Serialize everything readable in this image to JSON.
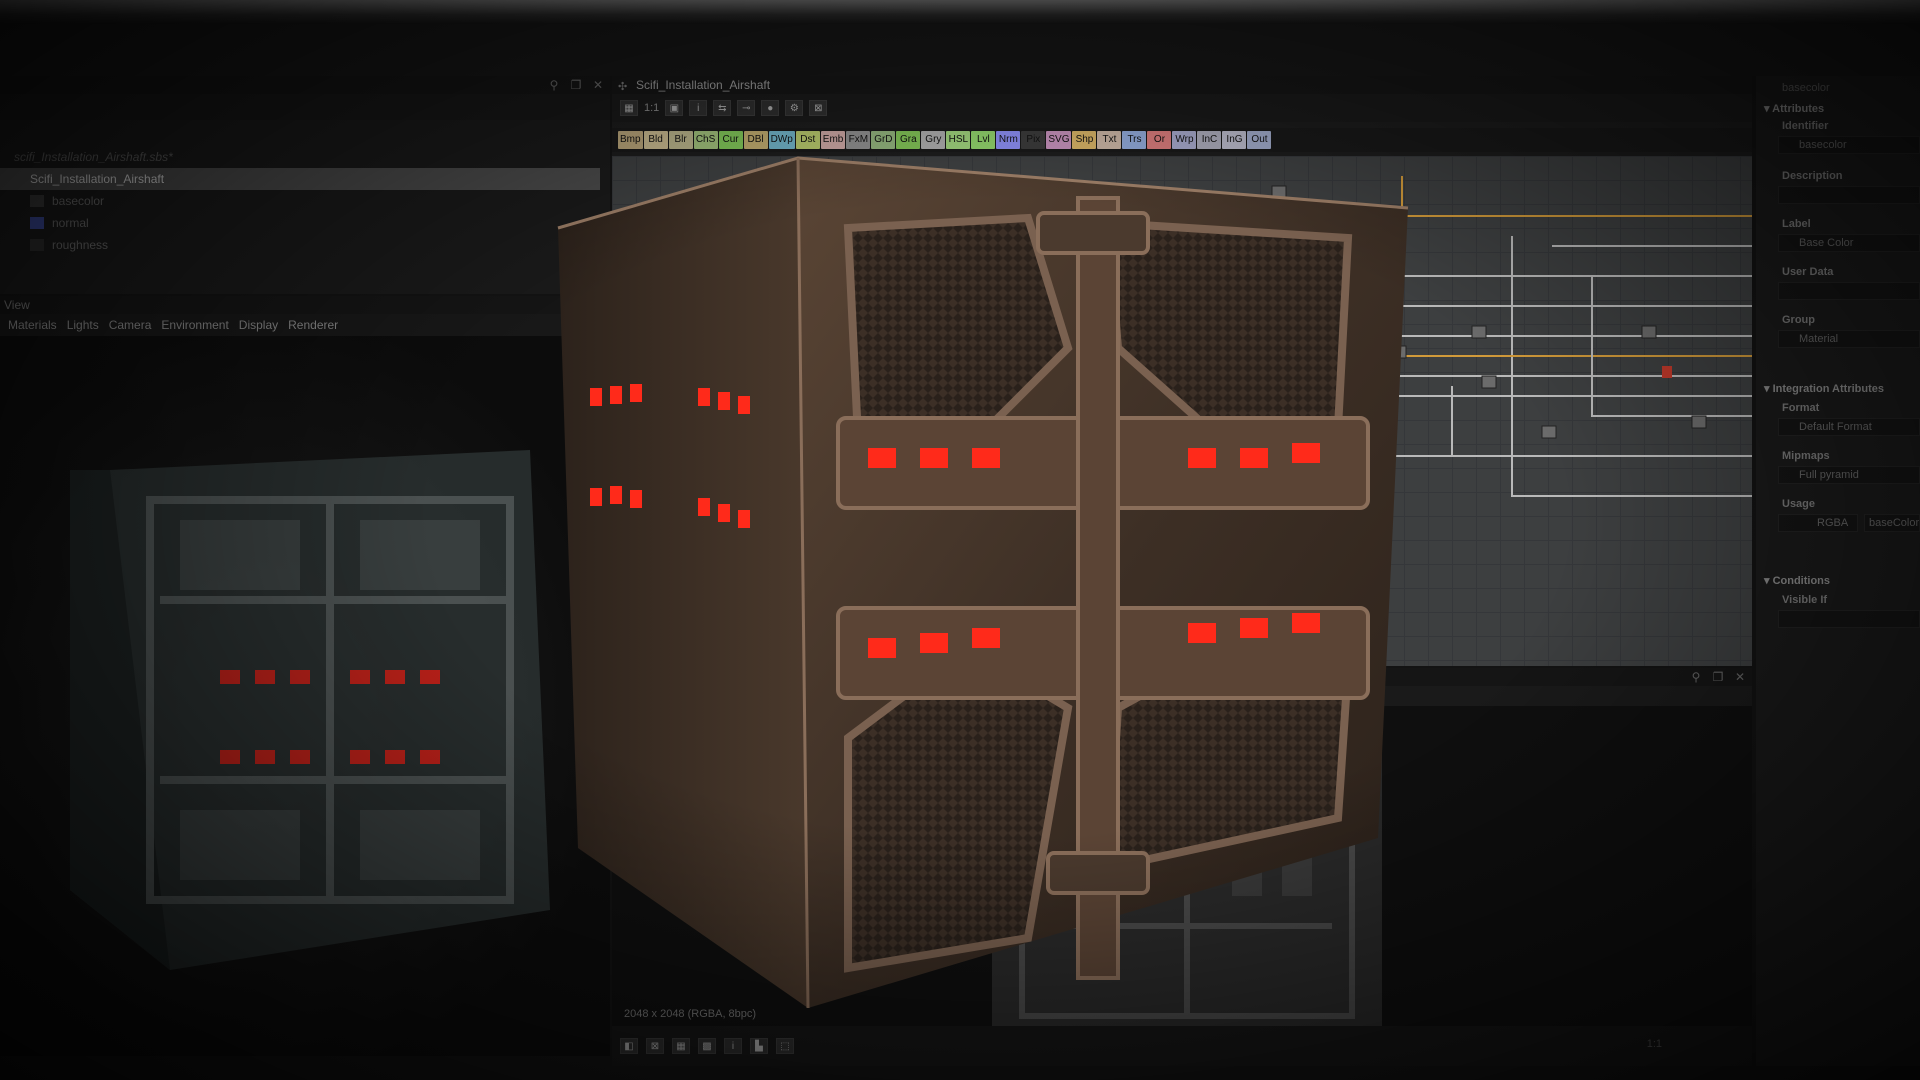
{
  "explorer": {
    "package": "scifi_Installation_Airshaft.sbs*",
    "graph": "Scifi_Installation_Airshaft",
    "outputs": [
      {
        "label": "basecolor",
        "color": "#3a3a3a"
      },
      {
        "label": "normal",
        "color": "#3b4a9a"
      },
      {
        "label": "roughness",
        "color": "#2e2e2e"
      }
    ]
  },
  "view3d": {
    "title": "View",
    "menu": [
      "Materials",
      "Lights",
      "Camera",
      "Environment",
      "Display",
      "Renderer"
    ]
  },
  "graph": {
    "title": "Scifi_Installation_Airshaft",
    "zoom_label": "1:1",
    "node_buttons": [
      {
        "label": "Bmp",
        "color": "#b9a57a"
      },
      {
        "label": "Bld",
        "color": "#c8b98f"
      },
      {
        "label": "Blr",
        "color": "#b8b38a"
      },
      {
        "label": "ChS",
        "color": "#9fbf7a"
      },
      {
        "label": "Cur",
        "color": "#7fc458"
      },
      {
        "label": "DBl",
        "color": "#bda96d"
      },
      {
        "label": "DWp",
        "color": "#6fb0c4"
      },
      {
        "label": "Dst",
        "color": "#b3c46a"
      },
      {
        "label": "Emb",
        "color": "#c7a3a0"
      },
      {
        "label": "FxM",
        "color": "#8c8c8c"
      },
      {
        "label": "GrD",
        "color": "#8fb07a"
      },
      {
        "label": "Gra",
        "color": "#7fbf55"
      },
      {
        "label": "Gry",
        "color": "#a9a9a9"
      },
      {
        "label": "HSL",
        "color": "#9ccf7a"
      },
      {
        "label": "Lvl",
        "color": "#8fd06a"
      },
      {
        "label": "Nrm",
        "color": "#8a8cf0"
      },
      {
        "label": "Pix",
        "color": "#3a3a3a"
      },
      {
        "label": "SVG",
        "color": "#c28fb8"
      },
      {
        "label": "Shp",
        "color": "#d4b065"
      },
      {
        "label": "Txt",
        "color": "#c7b2a2"
      },
      {
        "label": "Trs",
        "color": "#8fa7d6"
      },
      {
        "label": "Or",
        "color": "#d67a7a"
      },
      {
        "label": "Wrp",
        "color": "#a4a6c8"
      },
      {
        "label": "InC",
        "color": "#a9a9b8"
      },
      {
        "label": "InG",
        "color": "#b8b8c8"
      },
      {
        "label": "Out",
        "color": "#9fa9c8"
      }
    ]
  },
  "view2d": {
    "image_info": "2048 x 2048 (RGBA, 8bpc)",
    "zoom_label": "1:1"
  },
  "properties": {
    "top_label": "basecolor",
    "sections": {
      "attributes": "Attributes",
      "integration": "Integration Attributes",
      "conditions": "Conditions"
    },
    "fields": {
      "identifier_label": "Identifier",
      "identifier_value": "basecolor",
      "description_label": "Description",
      "label_label": "Label",
      "label_value": "Base Color",
      "user_data_label": "User Data",
      "group_label": "Group",
      "group_value": "Material",
      "format_label": "Format",
      "format_value": "Default Format",
      "mipmaps_label": "Mipmaps",
      "mipmaps_value": "Full pyramid",
      "usage_label": "Usage",
      "usage_value": "RGBA",
      "usage_value2": "baseColor",
      "visible_if_label": "Visible If"
    }
  },
  "colors": {
    "accent_orange": "#d19a3a",
    "wire_gray": "#b9b9b9",
    "selection_gray": "#4a4a4a",
    "emissive_red": "#ff2a1a"
  }
}
